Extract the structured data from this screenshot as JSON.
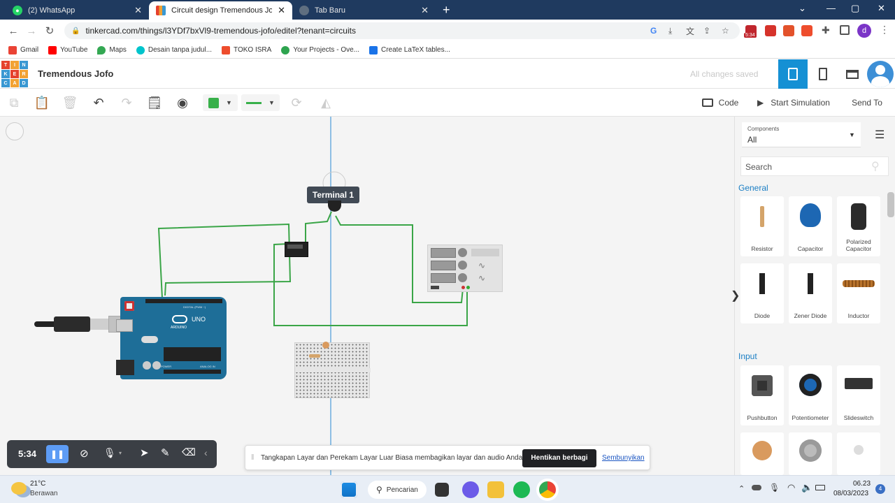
{
  "browser": {
    "tabs": [
      {
        "label": "(2) WhatsApp",
        "icon": "whatsapp-icon",
        "active": false
      },
      {
        "label": "Circuit design Tremendous Jofo |",
        "icon": "tinkercad-icon",
        "active": true
      },
      {
        "label": "Tab Baru",
        "icon": "chrome-icon",
        "active": false
      }
    ],
    "new_tab": "+",
    "url": "tinkercad.com/things/l3YDf7bxVl9-tremendous-jofo/editel?tenant=circuits",
    "badge": "5:34",
    "profile": "d",
    "bookmarks": [
      "Gmail",
      "YouTube",
      "Maps",
      "Desain tanpa judul...",
      "TOKO ISRA",
      "Your Projects - Ove...",
      "Create LaTeX tables..."
    ]
  },
  "app": {
    "logo": [
      "TIN",
      "KER",
      "CAD"
    ],
    "title": "Tremendous Jofo",
    "save_status": "All changes saved",
    "toolbar": {
      "code": "Code",
      "start_simulation": "Start Simulation",
      "send_to": "Send To"
    }
  },
  "canvas": {
    "tooltip": "Terminal 1",
    "arduino": {
      "brand": "ARDUINO",
      "model": "UNO",
      "digital": "DIGITAL (PWM ~)",
      "power": "POWER",
      "analog": "ANALOG IN"
    }
  },
  "panel": {
    "components_label": "Components",
    "components_value": "All",
    "search_placeholder": "Search",
    "sections": [
      {
        "title": "General",
        "items": [
          "Resistor",
          "Capacitor",
          "Polarized Capacitor",
          "Diode",
          "Zener Diode",
          "Inductor"
        ]
      },
      {
        "title": "Input",
        "items": [
          "Pushbutton",
          "Potentiometer",
          "Slideswitch"
        ]
      }
    ]
  },
  "recorder": {
    "time": "5:34"
  },
  "share_bar": {
    "message": "Tangkapan Layar dan Perekam Layar Luar Biasa membagikan layar dan audio Anda.",
    "stop_button": "Hentikan berbagi",
    "hide_link": "Sembunyikan"
  },
  "taskbar": {
    "weather_temp": "21°C",
    "weather_desc": "Berawan",
    "search": "Pencarian",
    "time": "06.23",
    "date": "08/03/2023",
    "notifications": "4"
  }
}
